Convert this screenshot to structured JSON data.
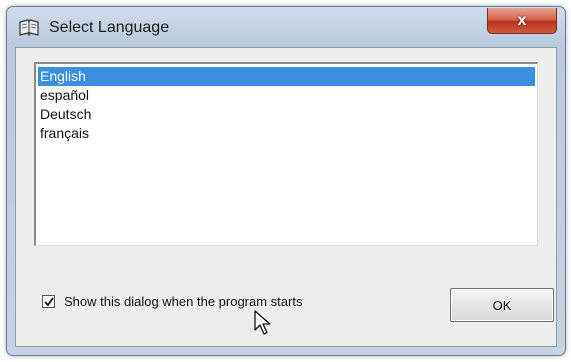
{
  "window": {
    "title": "Select Language",
    "close_label": "x",
    "icon": "book-icon"
  },
  "language_list": {
    "items": [
      {
        "label": "English",
        "selected": true
      },
      {
        "label": "español",
        "selected": false
      },
      {
        "label": "Deutsch",
        "selected": false
      },
      {
        "label": "français",
        "selected": false
      }
    ]
  },
  "options": {
    "show_dialog_label": "Show this dialog when the program starts",
    "show_dialog_checked": true
  },
  "buttons": {
    "ok_label": "OK"
  },
  "colors": {
    "selection": "#3b8ee0",
    "close_button": "#c4432b"
  },
  "cursor": "pointer-arrow-icon"
}
